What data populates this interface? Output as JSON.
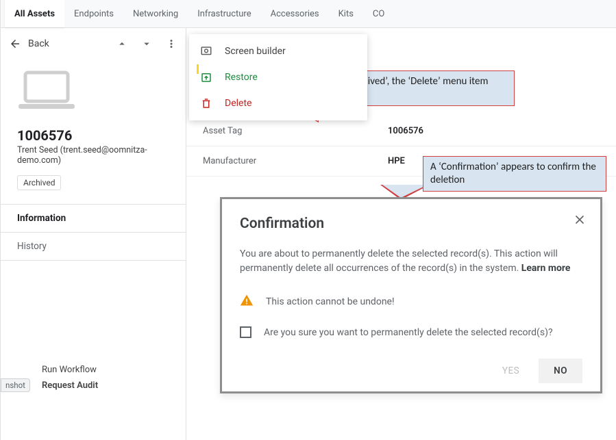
{
  "tabs": [
    {
      "label": "All Assets",
      "active": true
    },
    {
      "label": "Endpoints"
    },
    {
      "label": "Networking"
    },
    {
      "label": "Infrastructure"
    },
    {
      "label": "Accessories"
    },
    {
      "label": "Kits"
    },
    {
      "label": "CO"
    }
  ],
  "toolbar": {
    "back_label": "Back"
  },
  "menu": {
    "screen_builder": "Screen builder",
    "restore": "Restore",
    "delete": "Delete"
  },
  "asset": {
    "id": "1006576",
    "user": "Trent Seed (trent.seed@oomnitza-demo.com)",
    "status_badge": "Archived"
  },
  "sidebar_tabs": {
    "information": "Information",
    "history": "History"
  },
  "sidebar_footer": {
    "run_workflow": "Run Workflow",
    "request_audit": "Request Audit"
  },
  "overlay_chip": "nshot",
  "details": {
    "asset_tag_label": "Asset Tag",
    "asset_tag_value": "1006576",
    "manufacturer_label": "Manufacturer",
    "manufacturer_value": "HPE"
  },
  "annotations": {
    "one": "Once ‘archived’, the ‘Delete’ menu item appears",
    "two": "A ‘Confirmation’ appears to confirm the deletion"
  },
  "dialog": {
    "title": "Confirmation",
    "body_part1": "You are about to permanently delete the selected record(s). This action will permanently delete all occurrences of the record(s) in the system.  ",
    "learn_more": "Learn more",
    "warning": "This action cannot be undone!",
    "checkbox": "Are you sure you want to permanently delete the selected record(s)?",
    "yes": "YES",
    "no": "NO"
  }
}
